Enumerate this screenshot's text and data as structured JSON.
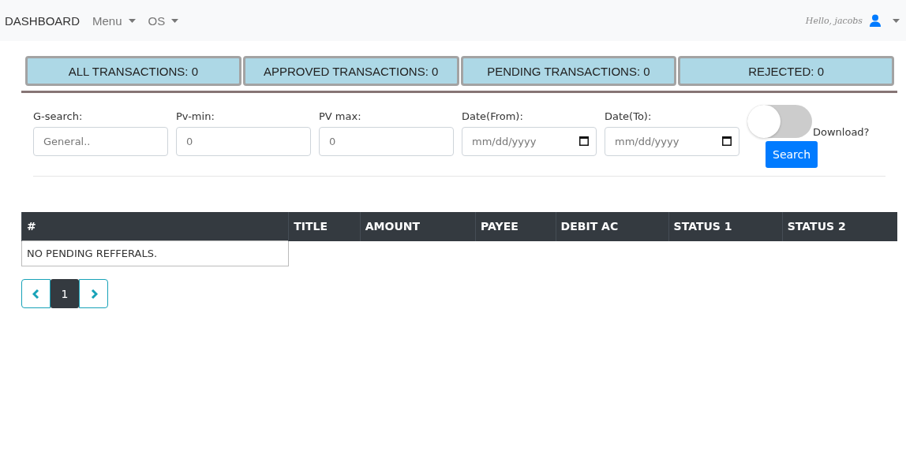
{
  "navbar": {
    "brand": "DASHBOARD",
    "menus": [
      {
        "label": "Menu"
      },
      {
        "label": "OS"
      }
    ],
    "greeting": "Hello, jacobs"
  },
  "stat_tabs": [
    {
      "label": "ALL TRANSACTIONS: 0"
    },
    {
      "label": "APPROVED TRANSACTIONS: 0"
    },
    {
      "label": "PENDING TRANSACTIONS: 0"
    },
    {
      "label": "REJECTED: 0"
    }
  ],
  "filters": [
    {
      "kind": "text",
      "label": "G-search:",
      "placeholder": "General.."
    },
    {
      "kind": "text",
      "label": "Pv-min:",
      "placeholder": "0"
    },
    {
      "kind": "text",
      "label": "PV max:",
      "placeholder": "0"
    },
    {
      "kind": "date",
      "label": "Date(From):",
      "placeholder": "mm/dd/yyyy"
    },
    {
      "kind": "date",
      "label": "Date(To):",
      "placeholder": "mm/dd/yyyy"
    }
  ],
  "download_toggle": {
    "label": "Download?",
    "on": false
  },
  "search_button": "Search",
  "table": {
    "columns": [
      "#",
      "TITLE",
      "AMOUNT",
      "PAYEE",
      "DEBIT AC",
      "STATUS 1",
      "STATUS 2"
    ],
    "empty_message": "NO PENDING REFFERALS."
  },
  "pagination": {
    "pages": [
      {
        "label": "1",
        "selected": true
      }
    ]
  }
}
